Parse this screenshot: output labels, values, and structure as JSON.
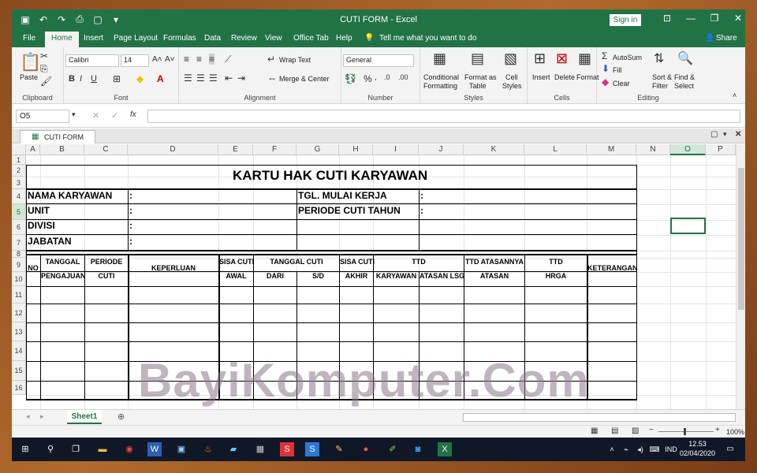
{
  "window": {
    "title": "CUTI FORM  -  Excel",
    "signin": "Sign in"
  },
  "menu": [
    "File",
    "Home",
    "Insert",
    "Page Layout",
    "Formulas",
    "Data",
    "Review",
    "View",
    "Office Tab",
    "Help"
  ],
  "tell_me": "Tell me what you want to do",
  "share": "Share",
  "ribbon": {
    "clipboard": {
      "label": "Clipboard",
      "paste": "Paste"
    },
    "font": {
      "label": "Font",
      "name": "Calibri",
      "size": "14"
    },
    "alignment": {
      "label": "Alignment",
      "wrap": "Wrap Text",
      "merge": "Merge & Center"
    },
    "number": {
      "label": "Number",
      "format": "General"
    },
    "styles": {
      "label": "Styles",
      "cond1": "Conditional",
      "cond2": "Formatting",
      "fmt1": "Format as",
      "fmt2": "Table",
      "cell1": "Cell",
      "cell2": "Styles"
    },
    "cells": {
      "label": "Cells",
      "insert": "Insert",
      "delete": "Delete",
      "format": "Format"
    },
    "editing": {
      "label": "Editing",
      "autosum": "AutoSum",
      "fill": "Fill",
      "clear": "Clear",
      "sort1": "Sort &",
      "sort2": "Filter",
      "find1": "Find &",
      "find2": "Select"
    }
  },
  "formula_bar": {
    "cell_ref": "O5",
    "fx": "fx",
    "value": ""
  },
  "doc_tab": "CUTI FORM",
  "columns": [
    "A",
    "B",
    "C",
    "D",
    "E",
    "F",
    "G",
    "H",
    "I",
    "J",
    "K",
    "L",
    "M",
    "N",
    "O",
    "P"
  ],
  "rows": [
    "1",
    "2",
    "3",
    "4",
    "5",
    "6",
    "7",
    "8",
    "9",
    "10",
    "11",
    "12",
    "13",
    "14",
    "15",
    "16"
  ],
  "form": {
    "title": "KARTU HAK CUTI KARYAWAN",
    "fields": {
      "nama": "NAMA KARYAWAN",
      "unit": "UNIT",
      "divisi": "DIVISI",
      "jabatan": "JABATAN",
      "mulai": "TGL. MULAI KERJA",
      "periode": "PERIODE CUTI TAHUN",
      "colon": ":"
    },
    "headers": {
      "no": "NO",
      "tanggal": "TANGGAL",
      "pengajuan": "PENGAJUAN",
      "periode": "PERIODE",
      "cuti": "CUTI",
      "keperluan": "KEPERLUAN",
      "sisa_cuti": "SISA CUTI",
      "awal": "AWAL",
      "tanggal_cuti": "TANGGAL CUTI",
      "dari": "DARI",
      "sd": "S/D",
      "sisa_cuti2": "SISA CUTI",
      "akhir": "AKHIR",
      "ttd": "TTD",
      "karyawan": "KARYAWAN",
      "atasan_lsg": "ATASAN LSG",
      "ttd_atasannya": "TTD  ATASANNYA",
      "atasan": "ATASAN",
      "ttd2": "TTD",
      "hrga": "HRGA",
      "keterangan": "KETERANGAN"
    }
  },
  "watermark": "BayiKomputer.Com",
  "sheet_tab": "Sheet1",
  "status": {
    "zoom": "100%"
  },
  "taskbar": {
    "lang": "IND",
    "time": "12.53",
    "date": "02/04/2020"
  }
}
